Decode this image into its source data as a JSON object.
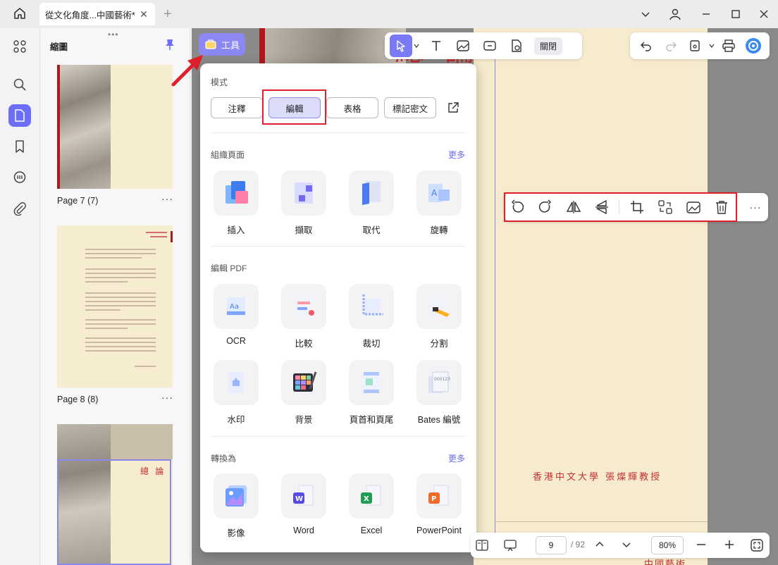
{
  "tab": {
    "title": "從文化角度...中國藝術*",
    "close": "✕"
  },
  "sidebar": {
    "title": "縮圖"
  },
  "thumbnails": [
    {
      "label": "Page 7 (7)"
    },
    {
      "label": "Page 8 (8)"
    },
    {
      "label": "總 論"
    }
  ],
  "tools_button": {
    "label": "工具"
  },
  "toolbar": {
    "close_label": "關閉"
  },
  "panel": {
    "mode_title": "模式",
    "modes": [
      "注釋",
      "編輯",
      "表格",
      "標記密文"
    ],
    "organize": {
      "title": "組織頁面",
      "more": "更多",
      "items": [
        "插入",
        "擷取",
        "取代",
        "旋轉"
      ]
    },
    "edit_pdf": {
      "title": "編輯 PDF",
      "items": [
        "OCR",
        "比較",
        "裁切",
        "分割",
        "水印",
        "背景",
        "頁首和頁尾",
        "Bates 編號"
      ]
    },
    "convert": {
      "title": "轉換為",
      "more": "更多",
      "items": [
        "影像",
        "Word",
        "Excel",
        "PowerPoint"
      ]
    }
  },
  "document": {
    "title": "總 論",
    "author": "香港中文大學 張燦輝教授",
    "footer": "中國藝術"
  },
  "bottombar": {
    "page": "9",
    "total": "/ 92",
    "zoom": "80%"
  },
  "colors": {
    "accent": "#6d6ef7",
    "highlight": "#e0212d",
    "doc_red": "#c82a2a",
    "paper": "#f6ebcd"
  }
}
